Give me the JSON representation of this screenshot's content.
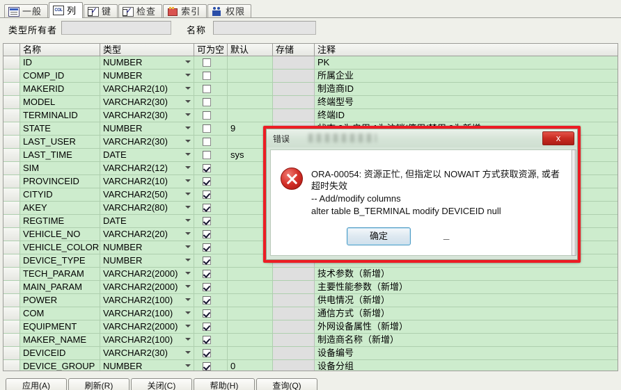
{
  "tabs": [
    {
      "label": "一般",
      "icon": "general-icon",
      "active": false
    },
    {
      "label": "列",
      "icon": "column-icon",
      "active": true
    },
    {
      "label": "键",
      "icon": "key-check-icon",
      "active": false
    },
    {
      "label": "检查",
      "icon": "check-icon",
      "active": false
    },
    {
      "label": "索引",
      "icon": "index-icon",
      "active": false
    },
    {
      "label": "权限",
      "icon": "privileges-icon",
      "active": false
    }
  ],
  "form": {
    "owner_label": "类型所有者",
    "owner_value": "",
    "name_label": "名称",
    "name_value": ""
  },
  "grid": {
    "headers": [
      "",
      "名称",
      "类型",
      "可为空",
      "默认",
      "存储",
      "注释"
    ],
    "rows": [
      {
        "name": "ID",
        "type": "NUMBER",
        "nullable": false,
        "default": "",
        "storage": "",
        "comment": "PK"
      },
      {
        "name": "COMP_ID",
        "type": "NUMBER",
        "nullable": false,
        "default": "",
        "storage": "",
        "comment": "所属企业"
      },
      {
        "name": "MAKERID",
        "type": "VARCHAR2(10)",
        "nullable": false,
        "default": "",
        "storage": "",
        "comment": "制造商ID"
      },
      {
        "name": "MODEL",
        "type": "VARCHAR2(30)",
        "nullable": false,
        "default": "",
        "storage": "",
        "comment": "终端型号"
      },
      {
        "name": "TERMINALID",
        "type": "VARCHAR2(30)",
        "nullable": false,
        "default": "",
        "storage": "",
        "comment": "终端ID"
      },
      {
        "name": "STATE",
        "type": "NUMBER",
        "nullable": false,
        "default": "9",
        "storage": "",
        "comment": "状态 0为启用 1为注销/停用/禁用 9为新增"
      },
      {
        "name": "LAST_USER",
        "type": "VARCHAR2(30)",
        "nullable": false,
        "default": "",
        "storage": "",
        "comment": ""
      },
      {
        "name": "LAST_TIME",
        "type": "DATE",
        "nullable": false,
        "default": "sys",
        "storage": "",
        "comment": ""
      },
      {
        "name": "SIM",
        "type": "VARCHAR2(12)",
        "nullable": true,
        "default": "",
        "storage": "",
        "comment": ""
      },
      {
        "name": "PROVINCEID",
        "type": "VARCHAR2(10)",
        "nullable": true,
        "default": "",
        "storage": "",
        "comment": ""
      },
      {
        "name": "CITYID",
        "type": "VARCHAR2(50)",
        "nullable": true,
        "default": "",
        "storage": "",
        "comment": ""
      },
      {
        "name": "AKEY",
        "type": "VARCHAR2(80)",
        "nullable": true,
        "default": "",
        "storage": "",
        "comment": ""
      },
      {
        "name": "REGTIME",
        "type": "DATE",
        "nullable": true,
        "default": "",
        "storage": "",
        "comment": ""
      },
      {
        "name": "VEHICLE_NO",
        "type": "VARCHAR2(20)",
        "nullable": true,
        "default": "",
        "storage": "",
        "comment": ""
      },
      {
        "name": "VEHICLE_COLOR",
        "type": "NUMBER",
        "nullable": true,
        "default": "",
        "storage": "",
        "comment": ""
      },
      {
        "name": "DEVICE_TYPE",
        "type": "NUMBER",
        "nullable": true,
        "default": "",
        "storage": "",
        "comment": ""
      },
      {
        "name": "TECH_PARAM",
        "type": "VARCHAR2(2000)",
        "nullable": true,
        "default": "",
        "storage": "",
        "comment": "技术参数（新增）"
      },
      {
        "name": "MAIN_PARAM",
        "type": "VARCHAR2(2000)",
        "nullable": true,
        "default": "",
        "storage": "",
        "comment": "主要性能参数（新增）"
      },
      {
        "name": "POWER",
        "type": "VARCHAR2(100)",
        "nullable": true,
        "default": "",
        "storage": "",
        "comment": "供电情况（新增）"
      },
      {
        "name": "COM",
        "type": "VARCHAR2(100)",
        "nullable": true,
        "default": "",
        "storage": "",
        "comment": "通信方式（新增）"
      },
      {
        "name": "EQUIPMENT",
        "type": "VARCHAR2(2000)",
        "nullable": true,
        "default": "",
        "storage": "",
        "comment": "外网设备属性（新增）"
      },
      {
        "name": "MAKER_NAME",
        "type": "VARCHAR2(100)",
        "nullable": true,
        "default": "",
        "storage": "",
        "comment": "制造商名称（新增）"
      },
      {
        "name": "DEVICEID",
        "type": "VARCHAR2(30)",
        "nullable": true,
        "default": "",
        "storage": "",
        "comment": "设备编号"
      },
      {
        "name": "DEVICE_GROUP",
        "type": "NUMBER",
        "nullable": true,
        "default": "0",
        "storage": "",
        "comment": "设备分组"
      }
    ],
    "new_row": {
      "marker": "✳",
      "storage_dots": "..."
    }
  },
  "buttons": [
    {
      "label": "应用(A)"
    },
    {
      "label": "刷新(R)"
    },
    {
      "label": "关闭(C)"
    },
    {
      "label": "帮助(H)"
    },
    {
      "label": "查询(Q)"
    }
  ],
  "dialog": {
    "caption": "错误",
    "close_label": "x",
    "message": "ORA-00054: 资源正忙, 但指定以 NOWAIT 方式获取资源, 或者超时失效",
    "sql_comment": "-- Add/modify columns",
    "sql_statement": "alter table B_TERMINAL modify DEVICEID null",
    "ok_label": "确定",
    "dash": "_"
  },
  "colors": {
    "grid_row_bg": "#cdeccd",
    "dialog_bg": "#d7e5d9",
    "highlight_border": "#ed1c24",
    "error_red": "#d32f28",
    "focus_blue": "#4d9bc4"
  }
}
